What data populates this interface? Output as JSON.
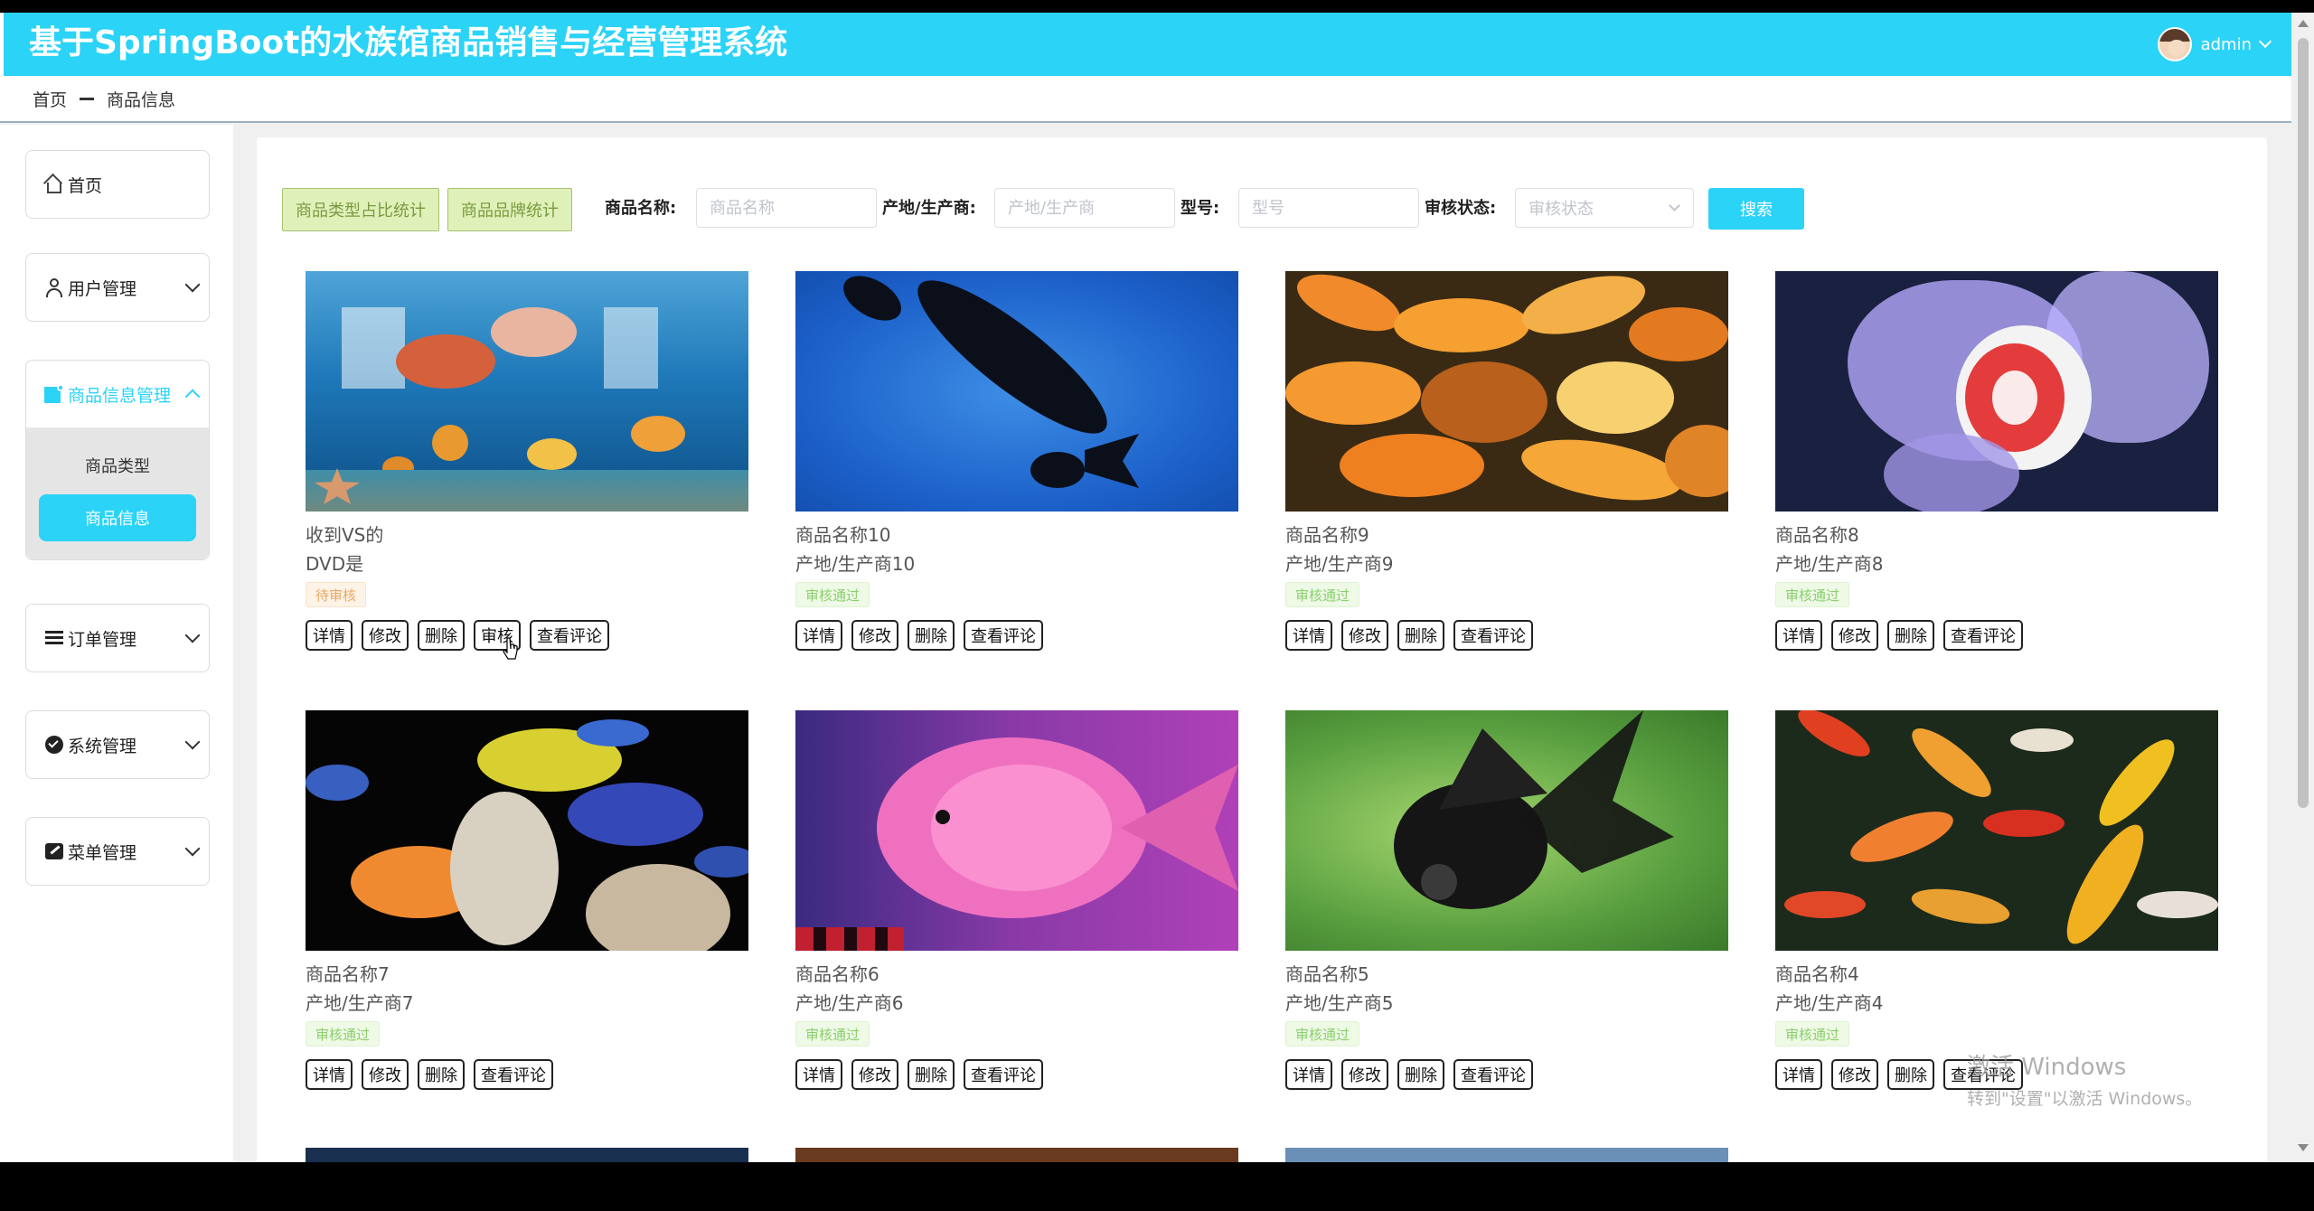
{
  "app": {
    "title": "基于SpringBoot的水族馆商品销售与经营管理系统",
    "user": "admin"
  },
  "breadcrumb": {
    "home": "首页",
    "current": "商品信息"
  },
  "sidebar": {
    "home": "首页",
    "groups": [
      {
        "label": "用户管理",
        "icon": "user-icon"
      },
      {
        "label": "商品信息管理",
        "icon": "goods-icon",
        "expanded": true,
        "children": [
          "商品类型",
          "商品信息"
        ],
        "selected": "商品信息"
      },
      {
        "label": "订单管理",
        "icon": "order-icon"
      },
      {
        "label": "系统管理",
        "icon": "system-icon"
      },
      {
        "label": "菜单管理",
        "icon": "menu-icon"
      }
    ]
  },
  "toolbar": {
    "stat_type": "商品类型占比统计",
    "stat_brand": "商品品牌统计",
    "name_label": "商品名称:",
    "name_placeholder": "商品名称",
    "origin_label": "产地/生产商:",
    "origin_placeholder": "产地/生产商",
    "model_label": "型号:",
    "model_placeholder": "型号",
    "audit_label": "审核状态:",
    "audit_placeholder": "审核状态",
    "search": "搜索"
  },
  "actions": {
    "detail": "详情",
    "edit": "修改",
    "delete": "删除",
    "audit": "审核",
    "comments": "查看评论"
  },
  "products": [
    {
      "name": "收到VS的",
      "origin": "DVD是",
      "status": "待审核",
      "status_type": "pending",
      "show_audit": true
    },
    {
      "name": "商品名称10",
      "origin": "产地/生产商10",
      "status": "审核通过",
      "status_type": "ok",
      "show_audit": false
    },
    {
      "name": "商品名称9",
      "origin": "产地/生产商9",
      "status": "审核通过",
      "status_type": "ok",
      "show_audit": false
    },
    {
      "name": "商品名称8",
      "origin": "产地/生产商8",
      "status": "审核通过",
      "status_type": "ok",
      "show_audit": false
    },
    {
      "name": "商品名称7",
      "origin": "产地/生产商7",
      "status": "审核通过",
      "status_type": "ok",
      "show_audit": false
    },
    {
      "name": "商品名称6",
      "origin": "产地/生产商6",
      "status": "审核通过",
      "status_type": "ok",
      "show_audit": false
    },
    {
      "name": "商品名称5",
      "origin": "产地/生产商5",
      "status": "审核通过",
      "status_type": "ok",
      "show_audit": false
    },
    {
      "name": "商品名称4",
      "origin": "产地/生产商4",
      "status": "审核通过",
      "status_type": "ok",
      "show_audit": false
    }
  ],
  "watermark": {
    "line1": "激活 Windows",
    "line2": "转到\"设置\"以激活 Windows。"
  }
}
